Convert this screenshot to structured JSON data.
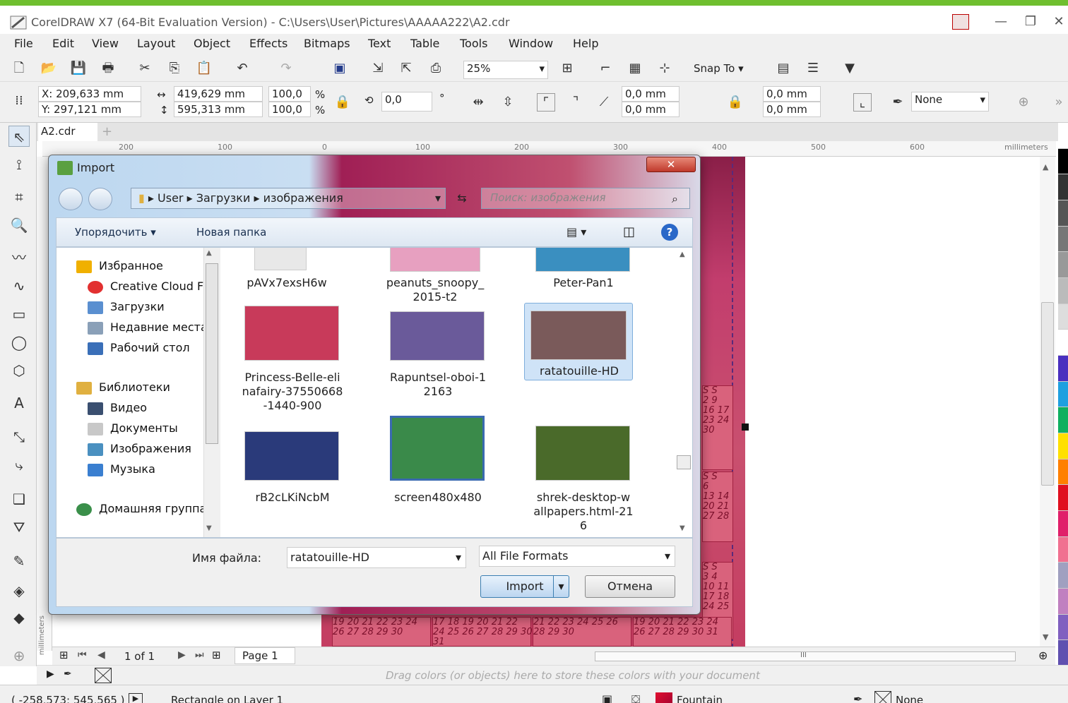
{
  "app": {
    "title": "CorelDRAW X7 (64-Bit Evaluation Version) - C:\\Users\\User\\Pictures\\AAAAA222\\A2.cdr"
  },
  "menu": [
    "File",
    "Edit",
    "View",
    "Layout",
    "Object",
    "Effects",
    "Bitmaps",
    "Text",
    "Table",
    "Tools",
    "Window",
    "Help"
  ],
  "toolbar": {
    "zoom": "25%",
    "snap_to": "Snap To"
  },
  "properties": {
    "x": "X: 209,633 mm",
    "y": "Y: 297,121 mm",
    "width": "419,629 mm",
    "height": "595,313 mm",
    "scale_w": "100,0",
    "scale_h": "100,0",
    "percent": "%",
    "rotation": "0,0",
    "degree": "°",
    "corner1": "0,0 mm",
    "corner2": "0,0 mm",
    "corner3": "0,0 mm",
    "corner4": "0,0 mm",
    "outline": "None"
  },
  "document": {
    "tab": "A2.cdr",
    "ruler_ticks": [
      "200",
      "100",
      "0",
      "100",
      "200",
      "300",
      "400",
      "500",
      "600"
    ],
    "ruler_unit": "millimeters",
    "ruler_v_unit": "millimeters"
  },
  "dialog": {
    "title": "Import",
    "breadcrumb": [
      "User",
      "Загрузки",
      "изображения"
    ],
    "search_placeholder": "Поиск: изображения",
    "organize": "Упорядочить",
    "new_folder": "Новая папка",
    "nav": [
      {
        "label": "Избранное",
        "color": "#f0b000"
      },
      {
        "label": "Creative Cloud Fi",
        "color": "#e23030"
      },
      {
        "label": "Загрузки",
        "color": "#5a8fd0"
      },
      {
        "label": "Недавние места",
        "color": "#8aa0b8"
      },
      {
        "label": "Рабочий стол",
        "color": "#3a6fb8"
      },
      {
        "label": "Библиотеки",
        "color": "#e0b040"
      },
      {
        "label": "Видео",
        "color": "#3a4f70"
      },
      {
        "label": "Документы",
        "color": "#c8c8c8"
      },
      {
        "label": "Изображения",
        "color": "#4a90c0"
      },
      {
        "label": "Музыка",
        "color": "#3a7fd0"
      },
      {
        "label": "Домашняя группа",
        "color": "#3a8f4a"
      }
    ],
    "files": [
      {
        "name": "pAVx7exsH6w",
        "color": "#e8e8e8"
      },
      {
        "name": "peanuts_snoopy_\n2015-t2",
        "color": "#e7a0c0"
      },
      {
        "name": "Peter-Pan1",
        "color": "#3a8fc0"
      },
      {
        "name": "Princess-Belle-eli\nnafairy-37550668\n-1440-900",
        "color": "#c83a5a"
      },
      {
        "name": "Rapuntsel-oboi-1\n2163",
        "color": "#6a5a9a"
      },
      {
        "name": "ratatouille-HD",
        "color": "#7a5a5a"
      },
      {
        "name": "rB2cLKiNcbM",
        "color": "#2a3a7a"
      },
      {
        "name": "screen480x480",
        "color": "#3a8a4a"
      },
      {
        "name": "shrek-desktop-w\nallpapers.html-21\n6",
        "color": "#4a6a2a"
      }
    ],
    "filename_label": "Имя файла:",
    "filename_value": "ratatouille-HD",
    "file_format": "All File Formats",
    "import_btn": "Import",
    "cancel_btn": "Отмена"
  },
  "pagebar": {
    "page_count": "1 of 1",
    "page_tab": "Page 1"
  },
  "colorbar": {
    "hint": "Drag colors (or objects) here to store these colors with your document"
  },
  "status": {
    "coords": "( -258,573; 545,565 )",
    "object": "Rectangle on Layer 1",
    "fill": "Fountain",
    "outline": "None"
  },
  "calendar": {
    "rows_bottom": [
      "19 20 21 22 23 24",
      "26 27 28 29 30",
      "17 18 19 20 21 22",
      "24 25 26 27 28 29 30",
      "31",
      "21 22 23 24 25 26",
      "28 29 30",
      "19 20 21 22 23 24",
      "26 27 28 29 30 31"
    ],
    "side": [
      "S S",
      "2 9",
      "16 17",
      "23 24",
      "30",
      "S S",
      "6",
      "13 14",
      "20 21",
      "27 28",
      "S S",
      "3 4",
      "10 11",
      "17 18",
      "24 25"
    ]
  },
  "palette_colors": [
    "#ffffff",
    "#000000",
    "#333333",
    "#555555",
    "#777777",
    "#999999",
    "#bbbbbb",
    "#dddddd",
    "#ffffff",
    "#4a2fbf",
    "#1fa0e0",
    "#10b060",
    "#ffe000",
    "#ff8000",
    "#e01020",
    "#e0206a",
    "#f07090",
    "#a0a0c0",
    "#c080c0",
    "#8060c0",
    "#6050b0"
  ]
}
